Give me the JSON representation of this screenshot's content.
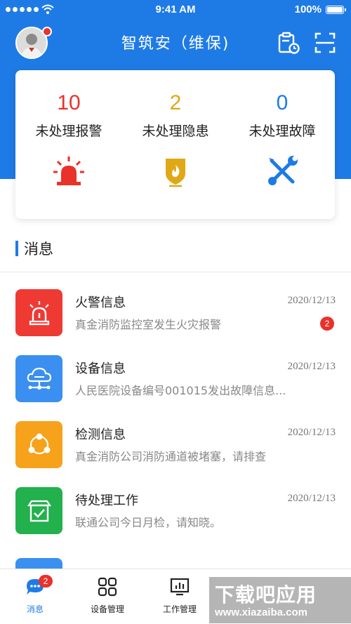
{
  "status_bar": {
    "time": "9:41 AM",
    "battery": "100%"
  },
  "header": {
    "title": "智筑安（维保)"
  },
  "stats": [
    {
      "value": "10",
      "label": "未处理报警",
      "color": "#e8322a",
      "icon": "alarm-light-icon"
    },
    {
      "value": "2",
      "label": "未处理隐患",
      "color": "#e0a817",
      "icon": "fire-shield-icon"
    },
    {
      "value": "0",
      "label": "未处理故障",
      "color": "#1e7be6",
      "icon": "tools-icon"
    }
  ],
  "section": {
    "title": "消息"
  },
  "messages": [
    {
      "title": "火警信息",
      "date": "2020/12/13",
      "text": "真金消防监控室发生火灾报警",
      "badge": "2",
      "icon": "alarm-light-icon",
      "color": "#ef3a34"
    },
    {
      "title": "设备信息",
      "date": "2020/12/13",
      "text": "人民医院设备编号001015发出故障信息...",
      "badge": "",
      "icon": "cloud-network-icon",
      "color": "#3a8ff0"
    },
    {
      "title": "检测信息",
      "date": "2020/12/13",
      "text": "真金消防公司消防通道被堵塞，请排查",
      "badge": "",
      "icon": "triangle-nodes-icon",
      "color": "#f7a21b"
    },
    {
      "title": "待处理工作",
      "date": "2020/12/13",
      "text": "联通公司今日月检，请知晓。",
      "badge": "",
      "icon": "task-box-icon",
      "color": "#22b14c"
    }
  ],
  "tabs": [
    {
      "label": "消息",
      "badge": "2",
      "icon": "message-icon"
    },
    {
      "label": "设备管理",
      "icon": "grid-icon"
    },
    {
      "label": "工作管理",
      "icon": "monitor-chart-icon"
    }
  ],
  "watermark": {
    "main": "下载吧应用",
    "sub": "www.xiazaiba.com"
  }
}
